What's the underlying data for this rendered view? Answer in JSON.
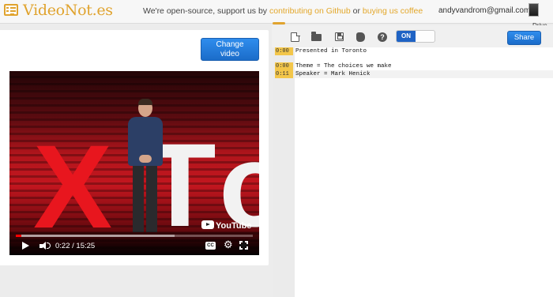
{
  "header": {
    "logo_text": "VideoNot.es",
    "tagline_prefix": "We're open-source, support us by",
    "github_link": "contributing on Github",
    "tagline_or": "or",
    "coffee_link": "buying us coffee",
    "email": "andyvandrom@gmail.com",
    "drive_label": "Drive"
  },
  "video_panel": {
    "change_video_line1": "Change",
    "change_video_line2": "video",
    "player": {
      "time_display": "0:22 / 15:25",
      "played_fraction": 0.024,
      "loaded_fraction": 0.67,
      "youtube_label": "YouTube",
      "cc_label": "CC"
    }
  },
  "editor": {
    "toggle_label": "ON",
    "share_label": "Share",
    "lines": [
      {
        "stamp": "0:00",
        "text": "Presented in Toronto"
      },
      {
        "stamp": "",
        "text": ""
      },
      {
        "stamp": "0:00",
        "text": "Theme = The choices we make"
      },
      {
        "stamp": "0:11",
        "text": "Speaker = Mark Henick"
      }
    ]
  },
  "colors": {
    "accent": "#e0a32e",
    "button_blue": "#1b6cc9",
    "stamp_yellow": "#f3c64a",
    "progress_red": "#ff0000"
  }
}
